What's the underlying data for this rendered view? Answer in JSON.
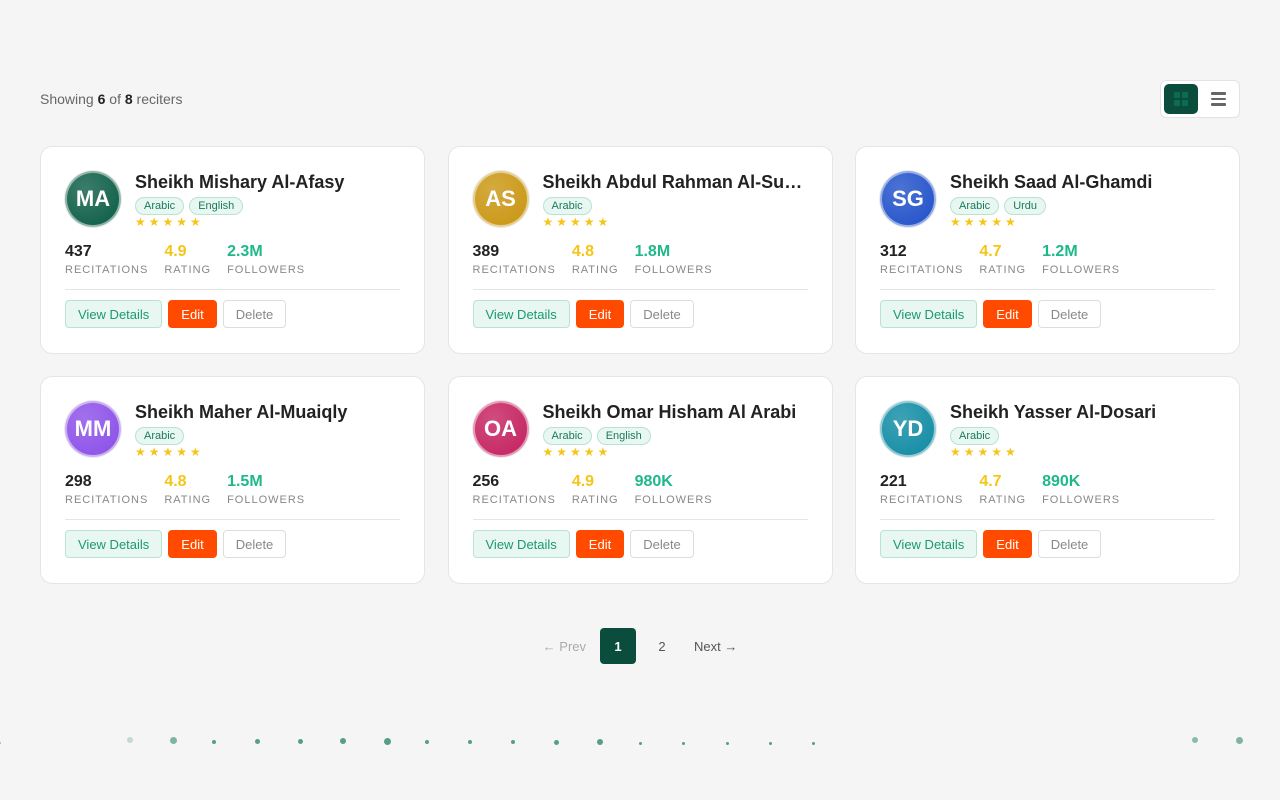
{
  "toolbar": {
    "showing_prefix": "Showing",
    "shown_count": "6",
    "of_text": "of",
    "total_count": "8",
    "suffix": "reciters",
    "view_modes": [
      "grid",
      "list"
    ],
    "active_view": "grid"
  },
  "stat_labels": {
    "recitations": "RECITATIONS",
    "rating": "RATING",
    "followers": "FOLLOWERS"
  },
  "actions": {
    "view": "View Details",
    "edit": "Edit",
    "delete": "Delete"
  },
  "stars_glyph": "★★★★★",
  "reciters": [
    {
      "initials": "MA",
      "name": "Sheikh Mishary Al-Afasy",
      "tags": [
        "Arabic",
        "English"
      ],
      "stars": 5,
      "recitations": "437",
      "rating": "4.9",
      "followers": "2.3M",
      "avatar_color": "#0a5c44"
    },
    {
      "initials": "AS",
      "name": "Sheikh Abdul Rahman Al-Sudais",
      "tags": [
        "Arabic"
      ],
      "stars": 5,
      "recitations": "389",
      "rating": "4.8",
      "followers": "1.8M",
      "avatar_color": "#c9950f"
    },
    {
      "initials": "SG",
      "name": "Sheikh Saad Al-Ghamdi",
      "tags": [
        "Arabic",
        "Urdu"
      ],
      "stars": 5,
      "recitations": "312",
      "rating": "4.7",
      "followers": "1.2M",
      "avatar_color": "#1f4fc9"
    },
    {
      "initials": "MM",
      "name": "Sheikh Maher Al-Muaiqly",
      "tags": [
        "Arabic"
      ],
      "stars": 5,
      "recitations": "298",
      "rating": "4.8",
      "followers": "1.5M",
      "avatar_color": "#8a4de8"
    },
    {
      "initials": "OA",
      "name": "Sheikh Omar Hisham Al Arabi",
      "tags": [
        "Arabic",
        "English"
      ],
      "stars": 5,
      "recitations": "256",
      "rating": "4.9",
      "followers": "980K",
      "avatar_color": "#c41f5e"
    },
    {
      "initials": "YD",
      "name": "Sheikh Yasser Al-Dosari",
      "tags": [
        "Arabic"
      ],
      "stars": 5,
      "recitations": "221",
      "rating": "4.7",
      "followers": "890K",
      "avatar_color": "#0e8aa3"
    }
  ],
  "pagination": {
    "prev": "← Prev",
    "next": "Next →",
    "pages": [
      "1",
      "2"
    ],
    "current": "1"
  },
  "colors": {
    "primary": "#0a4d3c",
    "accent": "#ff4a00",
    "green_stat": "#1fb88a",
    "gold": "#f5c518"
  }
}
